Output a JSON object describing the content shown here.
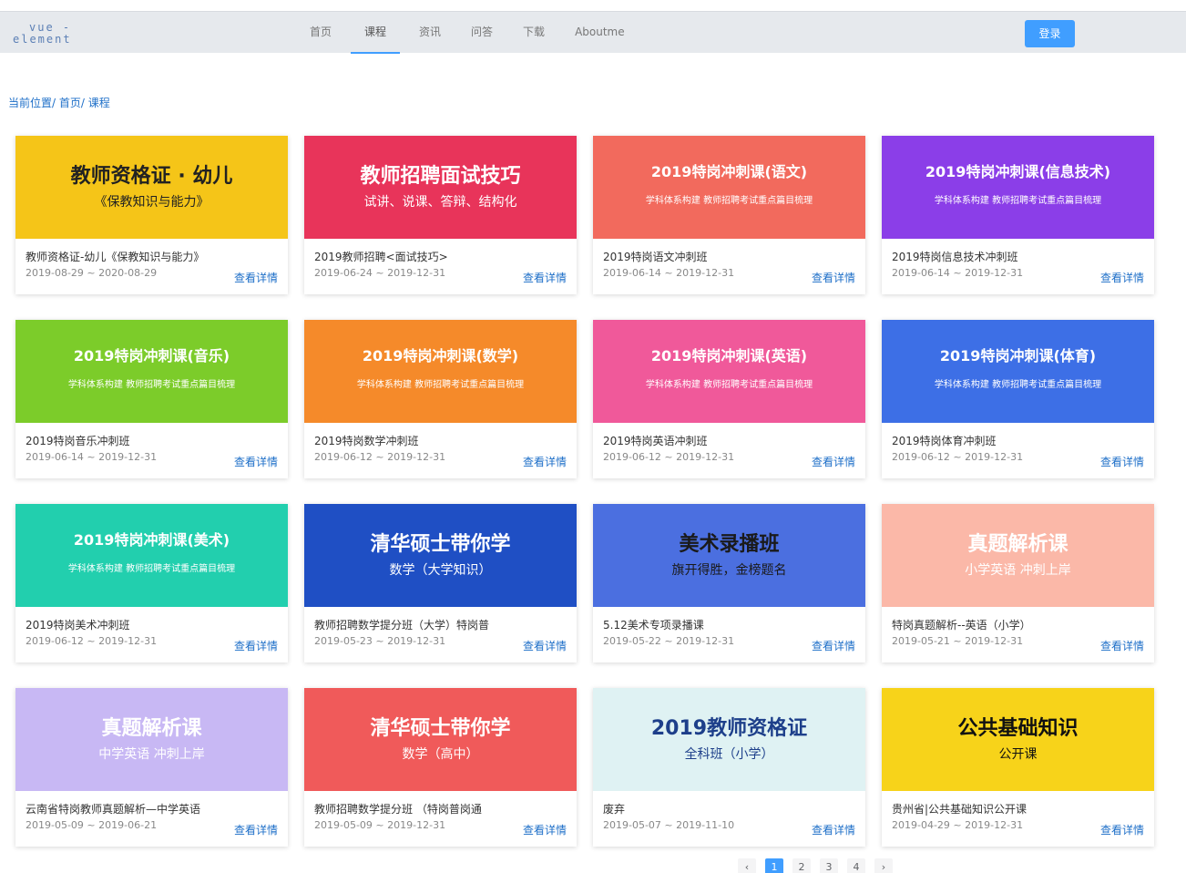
{
  "logo": {
    "line1": "vue -",
    "line2": "element"
  },
  "nav": [
    {
      "label": "首页",
      "active": false
    },
    {
      "label": "课程",
      "active": true
    },
    {
      "label": "资讯",
      "active": false
    },
    {
      "label": "问答",
      "active": false
    },
    {
      "label": "下载",
      "active": false
    },
    {
      "label": "Aboutme",
      "active": false
    }
  ],
  "login_label": "登录",
  "breadcrumb": "当前位置/ 首页/ 课程",
  "detail_label": "查看详情",
  "courses": [
    {
      "title": "教师资格证-幼儿《保教知识与能力》",
      "dates": "2019-08-29 ~ 2020-08-29",
      "banner": {
        "text": "教师资格证 · 幼儿",
        "sub": "《保教知识与能力》",
        "bg": "#f5c518",
        "fg": "#222"
      }
    },
    {
      "title": "2019教师招聘<面试技巧>",
      "dates": "2019-06-24 ~ 2019-12-31",
      "banner": {
        "text": "教师招聘面试技巧",
        "sub": "试讲、说课、答辩、结构化",
        "bg": "#e8345a",
        "fg": "#fff"
      }
    },
    {
      "title": "2019特岗语文冲刺班",
      "dates": "2019-06-14 ~ 2019-12-31",
      "banner": {
        "text": "2019特岗冲刺课(语文)",
        "sub": "学科体系构建 教师招聘考试重点篇目梳理",
        "bg": "#f26a5d",
        "fg": "#fff"
      }
    },
    {
      "title": "2019特岗信息技术冲刺班",
      "dates": "2019-06-14 ~ 2019-12-31",
      "banner": {
        "text": "2019特岗冲刺课(信息技术)",
        "sub": "学科体系构建 教师招聘考试重点篇目梳理",
        "bg": "#8b3ee8",
        "fg": "#fff"
      }
    },
    {
      "title": "2019特岗音乐冲刺班",
      "dates": "2019-06-14 ~ 2019-12-31",
      "banner": {
        "text": "2019特岗冲刺课(音乐)",
        "sub": "学科体系构建 教师招聘考试重点篇目梳理",
        "bg": "#7ccc2a",
        "fg": "#fff"
      }
    },
    {
      "title": "2019特岗数学冲刺班",
      "dates": "2019-06-12 ~ 2019-12-31",
      "banner": {
        "text": "2019特岗冲刺课(数学)",
        "sub": "学科体系构建 教师招聘考试重点篇目梳理",
        "bg": "#f58a2a",
        "fg": "#fff"
      }
    },
    {
      "title": "2019特岗英语冲刺班",
      "dates": "2019-06-12 ~ 2019-12-31",
      "banner": {
        "text": "2019特岗冲刺课(英语)",
        "sub": "学科体系构建 教师招聘考试重点篇目梳理",
        "bg": "#f0599a",
        "fg": "#fff"
      }
    },
    {
      "title": "2019特岗体育冲刺班",
      "dates": "2019-06-12 ~ 2019-12-31",
      "banner": {
        "text": "2019特岗冲刺课(体育)",
        "sub": "学科体系构建 教师招聘考试重点篇目梳理",
        "bg": "#3d6fe6",
        "fg": "#fff"
      }
    },
    {
      "title": "2019特岗美术冲刺班",
      "dates": "2019-06-12 ~ 2019-12-31",
      "banner": {
        "text": "2019特岗冲刺课(美术)",
        "sub": "学科体系构建 教师招聘考试重点篇目梳理",
        "bg": "#22cfae",
        "fg": "#fff"
      }
    },
    {
      "title": "教师招聘数学提分班（大学）特岗普",
      "dates": "2019-05-23 ~ 2019-12-31",
      "banner": {
        "text": "清华硕士带你学",
        "sub": "数学（大学知识）",
        "bg": "#1f4fc4",
        "fg": "#fff"
      }
    },
    {
      "title": "5.12美术专项录播课",
      "dates": "2019-05-22 ~ 2019-12-31",
      "banner": {
        "text": "美术录播班",
        "sub": "旗开得胜，金榜题名",
        "bg": "#4b6fe0",
        "fg": "#1a1a1a"
      }
    },
    {
      "title": "特岗真题解析--英语（小学）",
      "dates": "2019-05-21 ~ 2019-12-31",
      "banner": {
        "text": "真题解析课",
        "sub": "小学英语 冲刺上岸",
        "bg": "#fbb8a8",
        "fg": "#fff"
      }
    },
    {
      "title": "云南省特岗教师真题解析—中学英语",
      "dates": "2019-05-09 ~ 2019-06-21",
      "banner": {
        "text": "真题解析课",
        "sub": "中学英语 冲刺上岸",
        "bg": "#c8b8f4",
        "fg": "#fff"
      }
    },
    {
      "title": "教师招聘数学提分班 （特岗普岗通",
      "dates": "2019-05-09 ~ 2019-12-31",
      "banner": {
        "text": "清华硕士带你学",
        "sub": "数学（高中）",
        "bg": "#f05a5a",
        "fg": "#fff"
      }
    },
    {
      "title": "废弃",
      "dates": "2019-05-07 ~ 2019-11-10",
      "banner": {
        "text": "2019教师资格证",
        "sub": "全科班（小学）",
        "bg": "#dff2f3",
        "fg": "#1d3f8a"
      }
    },
    {
      "title": "贵州省|公共基础知识公开课",
      "dates": "2019-04-29 ~ 2019-12-31",
      "banner": {
        "text": "公共基础知识",
        "sub": "公开课",
        "bg": "#f7d31a",
        "fg": "#111"
      }
    }
  ],
  "pagination": {
    "prev": "‹",
    "pages": [
      "1",
      "2",
      "3",
      "4"
    ],
    "current": "1",
    "next": "›"
  }
}
